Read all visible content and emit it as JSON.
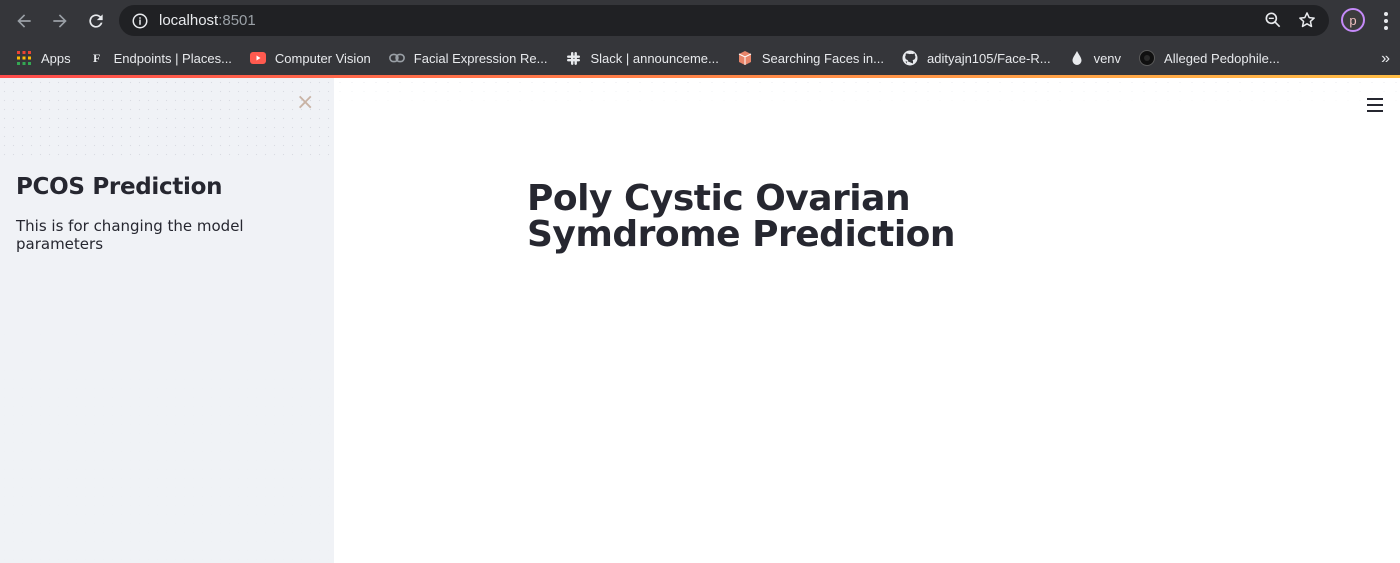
{
  "browser": {
    "url_host": "localhost",
    "url_port": ":8501",
    "bookmarks": [
      {
        "label": "Apps",
        "icon": "apps-grid-icon",
        "color": "#ea4335"
      },
      {
        "label": "Endpoints | Places...",
        "icon": "foursquare-icon",
        "color": "#e8eaed"
      },
      {
        "label": "Computer Vision",
        "icon": "youtube-icon",
        "color": "#ff5a4f"
      },
      {
        "label": "Facial Expression Re...",
        "icon": "link-icon",
        "color": "#9aa0a6"
      },
      {
        "label": "Slack | announceme...",
        "icon": "slack-icon",
        "color": "#e8eaed"
      },
      {
        "label": "Searching Faces in...",
        "icon": "box-icon",
        "color": "#e8856a"
      },
      {
        "label": "adityajn105/Face-R...",
        "icon": "github-icon",
        "color": "#e8eaed"
      },
      {
        "label": "venv",
        "icon": "drop-icon",
        "color": "#e8eaed"
      },
      {
        "label": "Alleged Pedophile...",
        "icon": "circle-icon",
        "color": "#101010"
      }
    ],
    "profile_initial": "p",
    "more_bookmarks": "»"
  },
  "sidebar": {
    "close_glyph": "×",
    "title": "PCOS Prediction",
    "text": "This is for changing the model parameters"
  },
  "main": {
    "title": "Poly Cystic Ovarian Symdrome Prediction"
  },
  "colors": {
    "accent_start": "#ff4b4b",
    "accent_end": "#ffbd45",
    "sidebar_bg": "#f0f2f6",
    "text": "#262730"
  }
}
